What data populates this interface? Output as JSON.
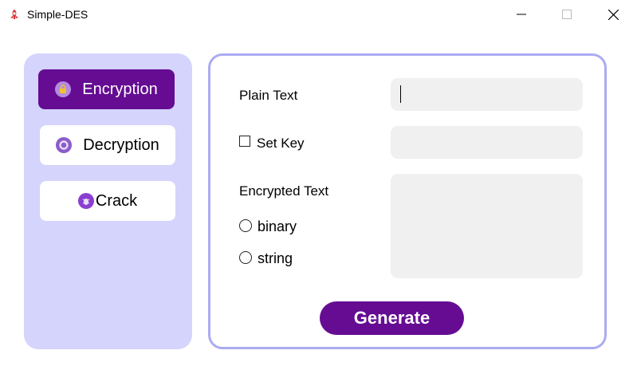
{
  "window": {
    "title": "Simple-DES"
  },
  "sidebar": {
    "items": [
      {
        "label": "Encryption",
        "icon": "lock-icon",
        "active": true
      },
      {
        "label": "Decryption",
        "icon": "unlock-icon",
        "active": false
      },
      {
        "label": "Crack",
        "icon": "bug-icon",
        "active": false
      }
    ]
  },
  "form": {
    "plain_text_label": "Plain Text",
    "plain_text_value": "",
    "set_key_label": "Set Key",
    "key_value": "",
    "encrypted_text_label": "Encrypted Text",
    "encrypted_value": "",
    "format_options": [
      "binary",
      "string"
    ],
    "generate_label": "Generate"
  },
  "colors": {
    "accent": "#650c93",
    "sidebar_bg": "#d4d4fd",
    "panel_border": "#ababf3",
    "field_bg": "#f0f0f0"
  }
}
